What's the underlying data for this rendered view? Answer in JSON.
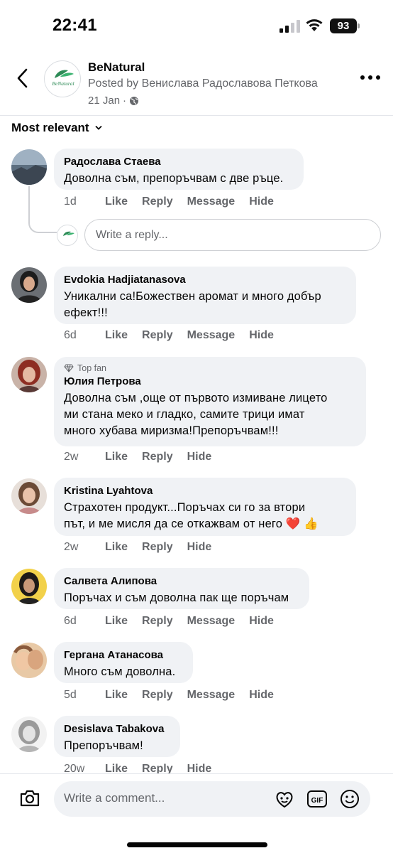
{
  "status": {
    "time": "22:41",
    "battery": "93"
  },
  "header": {
    "page_name": "BeNatural",
    "posted_by": "Posted by Венислава Радославова Петкова",
    "date": "21 Jan",
    "date_separator": "·",
    "avatar_text": "BeNatural"
  },
  "sort": {
    "label": "Most relevant"
  },
  "labels": {
    "like": "Like",
    "reply": "Reply",
    "message": "Message",
    "hide": "Hide",
    "top_fan": "Top fan"
  },
  "reply_input": {
    "placeholder": "Write a reply..."
  },
  "comments": [
    {
      "author": "Радослава Стаева",
      "lines": [
        "Доволна съм, препоръчвам с две ръце."
      ],
      "time": "1d"
    },
    {
      "author": "Evdokia Hadjiatanasova",
      "lines": [
        "Уникални са!Божествен аромат и много добър",
        "ефект!!!"
      ],
      "time": "6d"
    },
    {
      "author": "Юлия Петрова",
      "lines": [
        "Доволна съм ,още от първото измиване лицето",
        "ми стана меко и гладко, самите трици имат",
        "много хубава миризма!Препоръчвам!!!"
      ],
      "time": "2w"
    },
    {
      "author": "Kristina Lyahtova",
      "lines": [
        "Страхотен продукт...Поръчах си го за втори",
        "път, и ме мисля да се откажвам от него ❤️ 👍"
      ],
      "time": "2w"
    },
    {
      "author": "Салвета Алипова",
      "lines": [
        "Поръчах и съм доволна пак ще поръчам"
      ],
      "time": "6d"
    },
    {
      "author": "Гергана Атанасова",
      "lines": [
        "Много съм доволна."
      ],
      "time": "5d"
    },
    {
      "author": "Desislava Tabakova",
      "lines": [
        "Препоръчвам!"
      ],
      "time": "20w"
    }
  ],
  "composer": {
    "placeholder": "Write a comment...",
    "gif_label": "GIF"
  },
  "icons": [
    "back-arrow-icon",
    "more-icon",
    "globe-icon",
    "chevron-down-icon",
    "diamond-icon",
    "camera-icon",
    "avatar-sticker-icon",
    "gif-icon",
    "emoji-icon"
  ]
}
